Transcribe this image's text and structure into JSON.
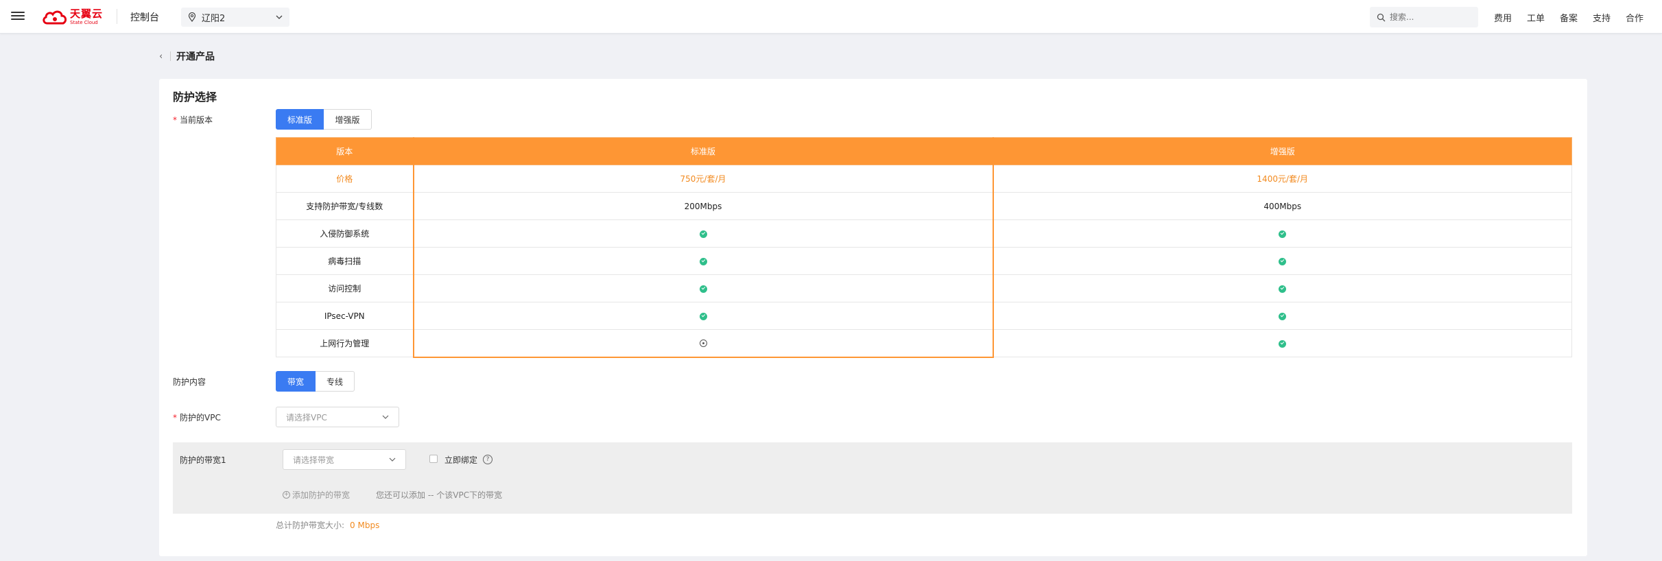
{
  "topbar": {
    "logo_cn": "天翼云",
    "logo_en": "State Cloud",
    "console": "控制台",
    "region": "辽阳2",
    "search_placeholder": "搜索...",
    "links": [
      "费用",
      "工单",
      "备案",
      "支持",
      "合作"
    ],
    "brand_color": "#e60012"
  },
  "page": {
    "title": "开通产品"
  },
  "card": {
    "section_title": "防护选择",
    "version": {
      "label": "当前版本",
      "options": [
        "标准版",
        "增强版"
      ],
      "selected": "标准版"
    },
    "table": {
      "headers": [
        "版本",
        "标准版",
        "增强版"
      ],
      "price_row": [
        "价格",
        "750元/套/月",
        "1400元/套/月"
      ],
      "bandwidth_row": [
        "支持防护带宽/专线数",
        "200Mbps",
        "400Mbps"
      ],
      "features": [
        {
          "name": "入侵防御系统",
          "standard": "check",
          "enhanced": "check"
        },
        {
          "name": "病毒扫描",
          "standard": "check",
          "enhanced": "check"
        },
        {
          "name": "访问控制",
          "standard": "check",
          "enhanced": "check"
        },
        {
          "name": "IPsec-VPN",
          "standard": "check",
          "enhanced": "check"
        },
        {
          "name": "上网行为管理",
          "standard": "optional",
          "enhanced": "check"
        }
      ],
      "header_color": "#fe9634"
    },
    "content": {
      "label": "防护内容",
      "options": [
        "带宽",
        "专线"
      ],
      "selected": "带宽"
    },
    "vpc": {
      "label": "防护的VPC",
      "placeholder": "请选择VPC"
    },
    "bandwidth_panel": {
      "label": "防护的带宽1",
      "placeholder": "请选择带宽",
      "bind_now": "立即绑定",
      "add_link": "添加防护的带宽",
      "hint": "您还可以添加 -- 个该VPC下的带宽"
    },
    "total": {
      "label": "总计防护带宽大小:",
      "value": "0 Mbps"
    }
  }
}
